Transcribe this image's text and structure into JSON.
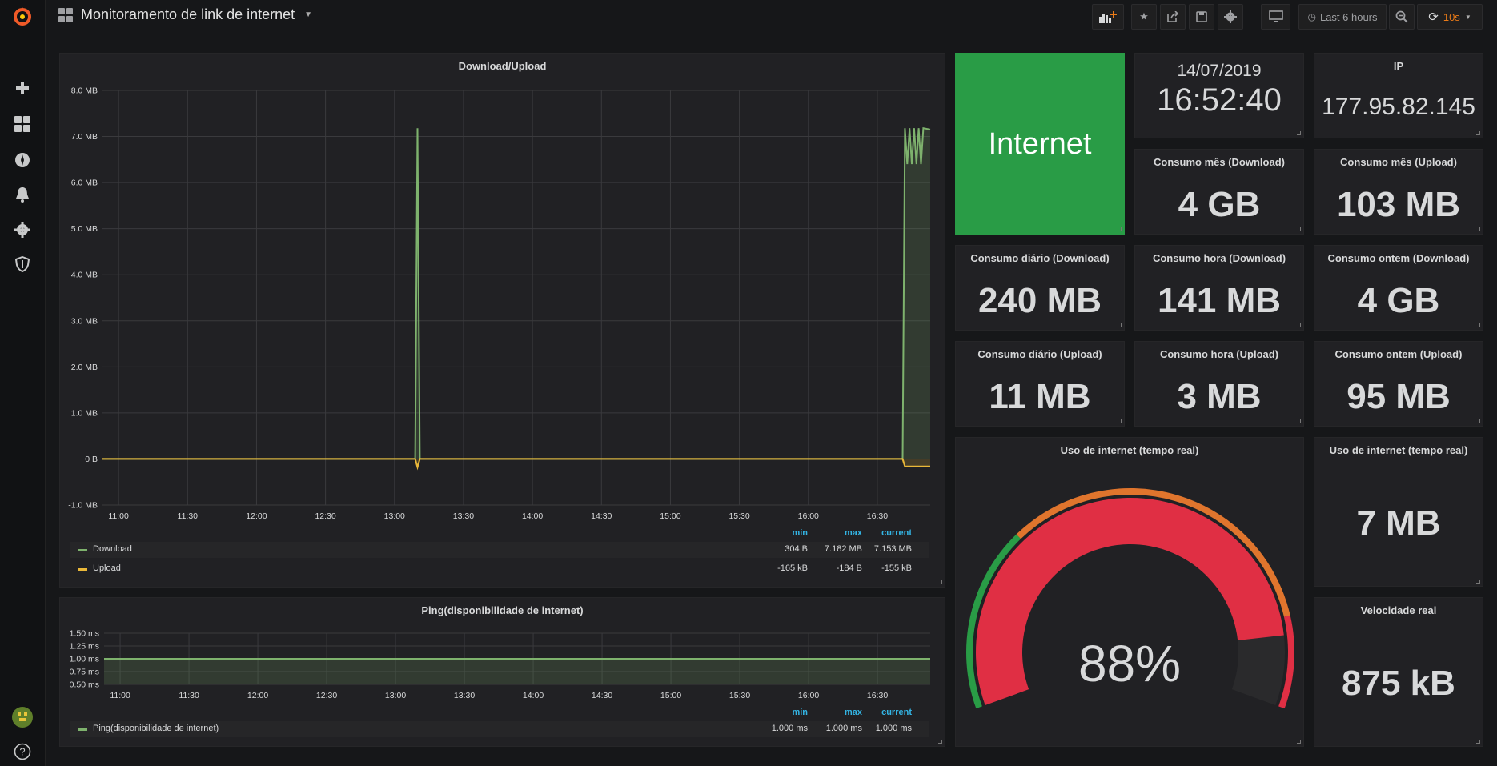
{
  "dashboard": {
    "title": "Monitoramento de link de internet"
  },
  "toolbar": {
    "time_range": "Last 6 hours",
    "refresh": "10s"
  },
  "sidemenu": {
    "icons": [
      "grafana-logo-icon",
      "plus-icon",
      "dashboards-icon",
      "explore-icon",
      "alerting-icon",
      "configuration-icon",
      "shield-icon",
      "user-avatar",
      "help-icon"
    ]
  },
  "status_panel": {
    "value": "Internet",
    "color": "#299c46"
  },
  "clock_panel": {
    "date": "14/07/2019",
    "time": "16:52:40"
  },
  "ip_panel": {
    "title": "IP",
    "value": "177.95.82.145"
  },
  "stat_panels": {
    "mes_download": {
      "title": "Consumo mês (Download)",
      "value": "4 GB"
    },
    "mes_upload": {
      "title": "Consumo mês (Upload)",
      "value": "103 MB"
    },
    "diario_download": {
      "title": "Consumo diário (Download)",
      "value": "240 MB"
    },
    "hora_download": {
      "title": "Consumo hora (Download)",
      "value": "141 MB"
    },
    "ontem_download": {
      "title": "Consumo ontem (Download)",
      "value": "4 GB"
    },
    "diario_upload": {
      "title": "Consumo diário (Upload)",
      "value": "11 MB"
    },
    "hora_upload": {
      "title": "Consumo hora (Upload)",
      "value": "3 MB"
    },
    "ontem_upload": {
      "title": "Consumo ontem (Upload)",
      "value": "95 MB"
    },
    "realtime_value": {
      "title": "Uso de internet (tempo real)",
      "value": "7 MB"
    },
    "velocidade": {
      "title": "Velocidade real",
      "value": "875 kB"
    }
  },
  "gauge_panel": {
    "title": "Uso de internet (tempo real)",
    "value_text": "88%",
    "value": 88,
    "thresholds": [
      {
        "upto": 30,
        "color": "#299c46"
      },
      {
        "upto": 85,
        "color": "#e0752d"
      },
      {
        "upto": 100,
        "color": "#e02f44"
      }
    ],
    "fill_color": "#e02f44"
  },
  "legend_headers": {
    "min": "min",
    "max": "max",
    "current": "current"
  },
  "chart_data": [
    {
      "type": "line",
      "title": "Download/Upload",
      "y_ticks": [
        "8.0 MB",
        "7.0 MB",
        "6.0 MB",
        "5.0 MB",
        "4.0 MB",
        "3.0 MB",
        "2.0 MB",
        "1.0 MB",
        "0 B",
        "-1.0 MB"
      ],
      "ylim": [
        -1.0,
        8.0
      ],
      "y_unit": "MB",
      "x_ticks": [
        "11:00",
        "11:30",
        "12:00",
        "12:30",
        "13:00",
        "13:30",
        "14:00",
        "14:30",
        "15:00",
        "15:30",
        "16:00",
        "16:30"
      ],
      "xlim": [
        "10:53",
        "16:53"
      ],
      "grid": true,
      "legend_placement": "bottom",
      "series": [
        {
          "name": "Download",
          "color": "#7eb26d",
          "points": [
            [
              "10:53",
              0
            ],
            [
              "13:09",
              0
            ],
            [
              "13:10",
              7.18
            ],
            [
              "13:11",
              0
            ],
            [
              "16:41",
              0
            ],
            [
              "16:42",
              7.18
            ],
            [
              "16:43",
              6.4
            ],
            [
              "16:44",
              7.18
            ],
            [
              "16:45",
              6.4
            ],
            [
              "16:46",
              7.18
            ],
            [
              "16:47",
              6.4
            ],
            [
              "16:48",
              7.18
            ],
            [
              "16:49",
              6.4
            ],
            [
              "16:50",
              7.18
            ],
            [
              "16:53",
              7.15
            ]
          ],
          "min": "304 B",
          "max": "7.182 MB",
          "current": "7.153 MB"
        },
        {
          "name": "Upload",
          "color": "#eab839",
          "points": [
            [
              "10:53",
              0
            ],
            [
              "13:09",
              0
            ],
            [
              "13:10",
              -0.18
            ],
            [
              "13:11",
              0
            ],
            [
              "16:41",
              0
            ],
            [
              "16:42",
              -0.16
            ],
            [
              "16:53",
              -0.16
            ]
          ],
          "min": "-165 kB",
          "max": "-184 B",
          "current": "-155 kB"
        }
      ]
    },
    {
      "type": "area",
      "title": "Ping(disponibilidade de internet)",
      "y_ticks": [
        "1.50 ms",
        "1.25 ms",
        "1.00 ms",
        "0.75 ms",
        "0.50 ms"
      ],
      "ylim": [
        0.5,
        1.5
      ],
      "y_unit": "ms",
      "x_ticks": [
        "11:00",
        "11:30",
        "12:00",
        "12:30",
        "13:00",
        "13:30",
        "14:00",
        "14:30",
        "15:00",
        "15:30",
        "16:00",
        "16:30"
      ],
      "xlim": [
        "10:53",
        "16:53"
      ],
      "grid": true,
      "legend_placement": "bottom",
      "series": [
        {
          "name": "Ping(disponibilidade de internet)",
          "color": "#7eb26d",
          "points": [
            [
              "10:53",
              1.0
            ],
            [
              "16:53",
              1.0
            ]
          ],
          "min": "1.000 ms",
          "max": "1.000 ms",
          "current": "1.000 ms"
        }
      ]
    }
  ]
}
